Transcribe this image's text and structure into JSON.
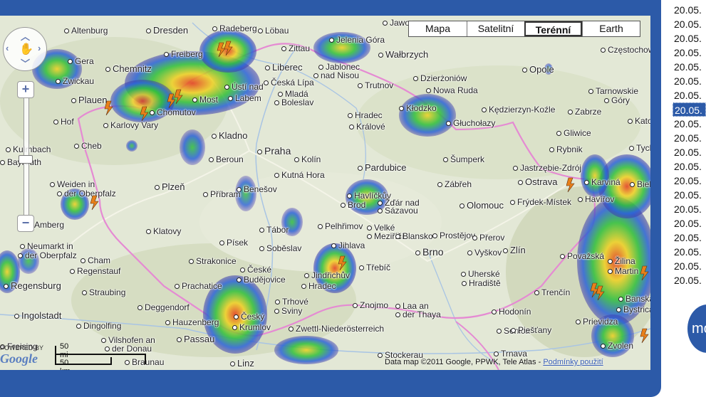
{
  "map_types": [
    "Mapa",
    "Satelitní",
    "Terénní",
    "Earth"
  ],
  "active_map_type": "Terénní",
  "zoom": {
    "in": "+",
    "out": "−"
  },
  "scale": {
    "imperial": "50 mi",
    "metric": "50 km"
  },
  "attribution": {
    "text": "Data map ©2011 Google, PPWK, Tele Atlas - ",
    "link": "Podmínky použití"
  },
  "google_logo": {
    "powered": "POWERED BY",
    "brand": "Google"
  },
  "labels": [
    {
      "t": "Dresden",
      "c": "city"
    },
    {
      "t": "Altenburg"
    },
    {
      "t": "Radeberg"
    },
    {
      "t": "Löbau"
    },
    {
      "t": "Zittau"
    },
    {
      "t": "Jelenia Góra"
    },
    {
      "t": "Jawor"
    },
    {
      "t": "Chemnitz",
      "c": "city"
    },
    {
      "t": "Freiberg"
    },
    {
      "t": "Gera"
    },
    {
      "t": "Zwickau"
    },
    {
      "t": "Plauen",
      "c": "city"
    },
    {
      "t": "Hof"
    },
    {
      "t": "Ústí nad"
    },
    {
      "t": "Labem"
    },
    {
      "t": "Most"
    },
    {
      "t": "Chomutov"
    },
    {
      "t": "Karlovy Vary"
    },
    {
      "t": "Cheb"
    },
    {
      "t": "Liberec",
      "c": "city"
    },
    {
      "t": "Česká Lípa"
    },
    {
      "t": "Jablonec"
    },
    {
      "t": "nad Nisou"
    },
    {
      "t": "Mladá"
    },
    {
      "t": "Boleslav"
    },
    {
      "t": "Trutnov"
    },
    {
      "t": "Wałbrzych",
      "c": "city"
    },
    {
      "t": "Dzierżoniów"
    },
    {
      "t": "Nowa Ruda"
    },
    {
      "t": "Kłodzko"
    },
    {
      "t": "Opole",
      "c": "city"
    },
    {
      "t": "Częstochowa"
    },
    {
      "t": "Kladno",
      "c": "city"
    },
    {
      "t": "Praha",
      "c": "big"
    },
    {
      "t": "Beroun"
    },
    {
      "t": "Kolín"
    },
    {
      "t": "Kutná Hora"
    },
    {
      "t": "Benešov"
    },
    {
      "t": "Hradec"
    },
    {
      "t": "Králové"
    },
    {
      "t": "Pardubice",
      "c": "city"
    },
    {
      "t": "Kędzierzyn-Koźle"
    },
    {
      "t": "Głuchołazy"
    },
    {
      "t": "Zabrze"
    },
    {
      "t": "Katowice"
    },
    {
      "t": "Tarnowskie"
    },
    {
      "t": "Góry"
    },
    {
      "t": "Gliwice"
    },
    {
      "t": "Rybnik"
    },
    {
      "t": "Tychy"
    },
    {
      "t": "Jastrzębie-Zdrój"
    },
    {
      "t": "Ostrava",
      "c": "city"
    },
    {
      "t": "Karviná"
    },
    {
      "t": "Havířov"
    },
    {
      "t": "Bielsko"
    },
    {
      "t": "Frýdek-Místek"
    },
    {
      "t": "Šumperk"
    },
    {
      "t": "Zábřeh"
    },
    {
      "t": "Olomouc",
      "c": "city"
    },
    {
      "t": "Weiden in"
    },
    {
      "t": "der Oberpfalz"
    },
    {
      "t": "Plzeň",
      "c": "city"
    },
    {
      "t": "Příbram"
    },
    {
      "t": "Bayreuth"
    },
    {
      "t": "Kulmbach"
    },
    {
      "t": "Amberg"
    },
    {
      "t": "Havlíčkův"
    },
    {
      "t": "Brod"
    },
    {
      "t": "Žďár nad"
    },
    {
      "t": "Sázavou"
    },
    {
      "t": "Velké"
    },
    {
      "t": "Meziříčí"
    },
    {
      "t": "Blansko"
    },
    {
      "t": "Prostějov"
    },
    {
      "t": "Přerov"
    },
    {
      "t": "Klatovy"
    },
    {
      "t": "Tábor"
    },
    {
      "t": "Pelhřimov"
    },
    {
      "t": "Jihlava"
    },
    {
      "t": "Písek"
    },
    {
      "t": "Soběslav"
    },
    {
      "t": "Brno",
      "c": "big"
    },
    {
      "t": "Vyškov"
    },
    {
      "t": "Zlín",
      "c": "city"
    },
    {
      "t": "Neumarkt in"
    },
    {
      "t": "der Oberpfalz"
    },
    {
      "t": "Cham"
    },
    {
      "t": "Regenstauf"
    },
    {
      "t": "Strakonice"
    },
    {
      "t": "České"
    },
    {
      "t": "Budějovice"
    },
    {
      "t": "Jindřichův"
    },
    {
      "t": "Hradec"
    },
    {
      "t": "Třebíč"
    },
    {
      "t": "Regensburg",
      "c": "city"
    },
    {
      "t": "Straubing"
    },
    {
      "t": "Prachatice"
    },
    {
      "t": "Trhové"
    },
    {
      "t": "Sviny"
    },
    {
      "t": "Znojmo"
    },
    {
      "t": "Laa an"
    },
    {
      "t": "der Thaya"
    },
    {
      "t": "Uherské"
    },
    {
      "t": "Hradiště"
    },
    {
      "t": "Považská"
    },
    {
      "t": "Žilina"
    },
    {
      "t": "Martin"
    },
    {
      "t": "Trenčín"
    },
    {
      "t": "Banská"
    },
    {
      "t": "Bystrica"
    },
    {
      "t": "Prievidza"
    },
    {
      "t": "Zvolen"
    },
    {
      "t": "Ingolstadt",
      "c": "city"
    },
    {
      "t": "Deggendorf"
    },
    {
      "t": "Dingolfing"
    },
    {
      "t": "Hauzenberg"
    },
    {
      "t": "Český"
    },
    {
      "t": "Krumlov"
    },
    {
      "t": "Zwettl-Niederösterreich"
    },
    {
      "t": "Hodonín"
    },
    {
      "t": "Senica"
    },
    {
      "t": "Piešťany"
    },
    {
      "t": "Passau",
      "c": "city"
    },
    {
      "t": "Vilshofen an"
    },
    {
      "t": "der Donau"
    },
    {
      "t": "Braunau"
    },
    {
      "t": "Linz",
      "c": "city"
    },
    {
      "t": "Stockerau"
    },
    {
      "t": "Trnava"
    },
    {
      "t": "Freising"
    }
  ],
  "timestamps": [
    "20.05.",
    "20.05.",
    "20.05.",
    "20.05.",
    "20.05.",
    "20.05.",
    "20.05.",
    "20.05.",
    "20.05.",
    "20.05.",
    "20.05.",
    "20.05.",
    "20.05.",
    "20.05.",
    "20.05.",
    "20.05.",
    "20.05.",
    "20.05.",
    "20.05.",
    "20.05."
  ],
  "selected_timestamp_index": 7,
  "more_button": "mo",
  "colors": {
    "frame": "#2c5aa8",
    "land": "#e4e8d8",
    "border": "#e58ad3"
  }
}
